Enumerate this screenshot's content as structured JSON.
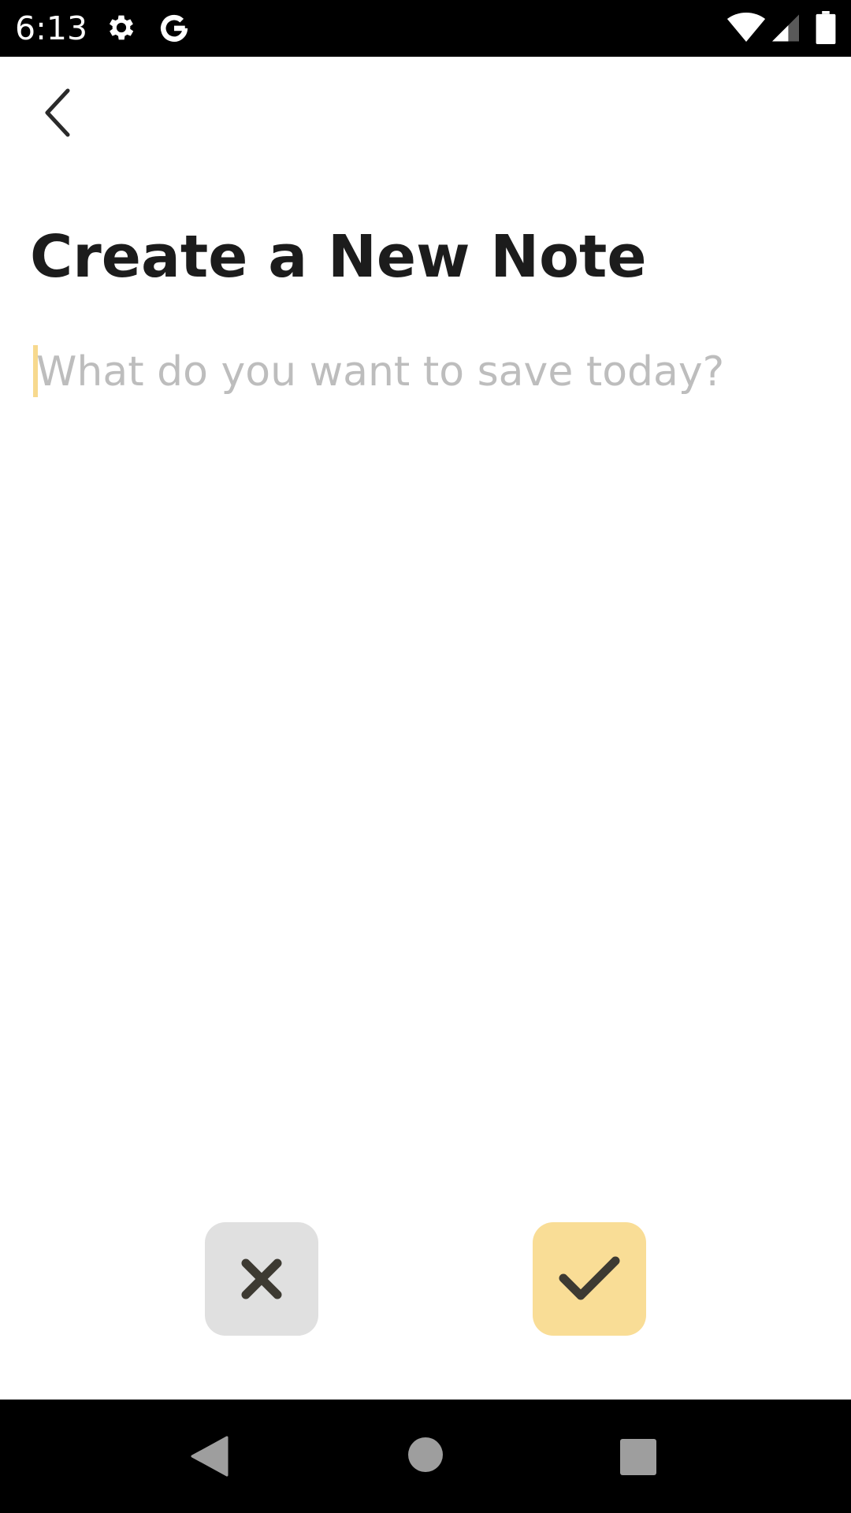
{
  "status_bar": {
    "time": "6:13",
    "icons": [
      "gear-icon",
      "google-g-icon",
      "wifi-icon",
      "cell-signal-icon",
      "battery-icon"
    ]
  },
  "header": {
    "back_icon": "chevron-left-icon"
  },
  "main": {
    "title": "Create a New Note",
    "note_input": {
      "value": "",
      "placeholder": "What do you want to save today?"
    }
  },
  "actions": {
    "cancel_icon": "close-icon",
    "confirm_icon": "check-icon"
  },
  "nav_bar": {
    "icons": [
      "nav-back-icon",
      "nav-home-icon",
      "nav-recents-icon"
    ]
  },
  "colors": {
    "accent": "#f9dd96",
    "cancel_bg": "#e0e0e0",
    "title_text": "#1c1c1c",
    "placeholder_text": "#bdbdbd",
    "icon_dark": "#3d3a32"
  }
}
